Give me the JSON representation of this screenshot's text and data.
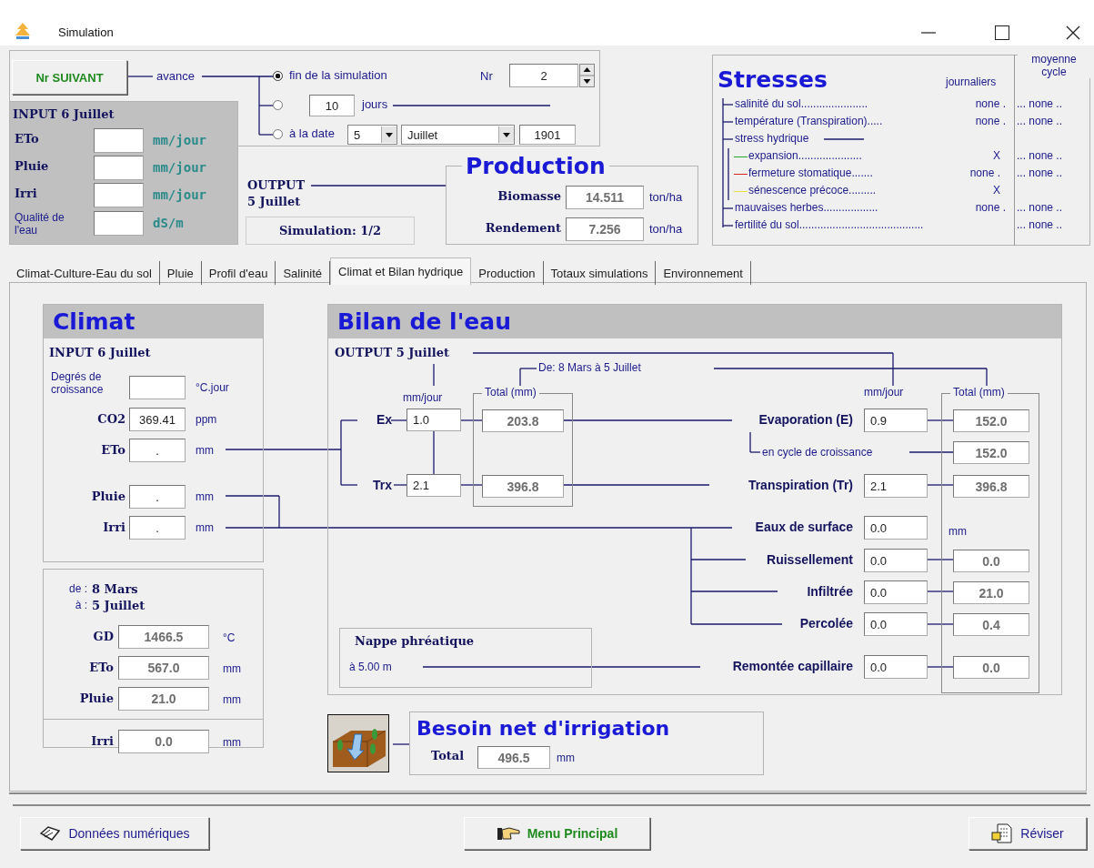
{
  "window": {
    "title": "Simulation"
  },
  "header": {
    "next_button": "Nr SUIVANT",
    "advance_label": "avance",
    "advance_options": [
      {
        "kind": "end",
        "label": "fin de la simulation",
        "selected": true
      },
      {
        "kind": "days",
        "value": "10",
        "label": "jours",
        "selected": false
      },
      {
        "kind": "date",
        "label": "à la date",
        "day": "5",
        "month": "Juillet",
        "year": "1901",
        "selected": false
      }
    ],
    "nr_label": "Nr",
    "nr_value": "2",
    "input": {
      "title": "INPUT",
      "date": "6 Juillet",
      "rows": [
        {
          "kind": "big",
          "label": "ETo",
          "unit": "mm/jour"
        },
        {
          "kind": "big",
          "label": "Pluie",
          "unit": "mm/jour"
        },
        {
          "kind": "big",
          "label": "Irri",
          "unit": "mm/jour"
        },
        {
          "kind": "small",
          "label": "Qualité de l'eau",
          "unit": "dS/m"
        }
      ]
    },
    "output": {
      "title": "OUTPUT",
      "date": "5 Juillet",
      "simulation": "Simulation: 1/2"
    },
    "production": {
      "title": "Production",
      "rows": [
        {
          "label": "Biomasse",
          "value": "14.511",
          "unit": "ton/ha"
        },
        {
          "label": "Rendement",
          "value": "7.256",
          "unit": "ton/ha"
        }
      ]
    },
    "stresses": {
      "title": "Stresses",
      "col_daily": "journaliers",
      "col_cycle": "moyenne cycle",
      "rows": [
        {
          "label": "salinité du sol......................",
          "daily": "none .",
          "cycle": "... none .."
        },
        {
          "label": "température (Transpiration).....",
          "daily": "none .",
          "cycle": "... none .."
        },
        {
          "label": "stress hydrique",
          "children": [
            {
              "label": "expansion.....................",
              "daily": "X",
              "cycle": "... none ..",
              "color": "#22aa22"
            },
            {
              "label": "fermeture stomatique.......",
              "daily": "none .",
              "cycle": "... none ..",
              "color": "#dd2222"
            },
            {
              "label": "sénescence précoce.........",
              "daily": "X",
              "color": "#e8e040"
            }
          ]
        },
        {
          "label": "mauvaises herbes..................",
          "daily": "none .",
          "cycle": "... none .."
        },
        {
          "label": "fertilité du sol.........................................",
          "cycle": "... none .."
        }
      ]
    }
  },
  "tabs": [
    {
      "label": "Climat-Culture-Eau du sol",
      "selected": false
    },
    {
      "label": "Pluie",
      "selected": false
    },
    {
      "label": "Profil d'eau",
      "selected": false
    },
    {
      "label": "Salinité",
      "selected": false
    },
    {
      "label": "Climat et Bilan hydrique",
      "selected": true
    },
    {
      "label": "Production",
      "selected": false
    },
    {
      "label": "Totaux simulations",
      "selected": false
    },
    {
      "label": "Environnement",
      "selected": false
    }
  ],
  "climat": {
    "title": "Climat",
    "input_title": "INPUT",
    "input_date": "6 Juillet",
    "rows": [
      {
        "kind": "small",
        "label": "Degrés de croissance",
        "unit": "°C.jour"
      },
      {
        "kind": "big",
        "label": "CO2",
        "value": "369.41",
        "unit": "ppm"
      },
      {
        "kind": "big",
        "label": "ETo",
        "value": ".",
        "unit": "mm"
      },
      {
        "kind": "big",
        "label": "Pluie",
        "value": ".",
        "unit": "mm"
      },
      {
        "kind": "big",
        "label": "Irri",
        "value": ".",
        "unit": "mm"
      }
    ],
    "from_label": "de :",
    "from_date": "8 Mars",
    "to_label": "à :",
    "to_date": "5 Juillet",
    "totals": [
      {
        "label": "GD",
        "value": "1466.5",
        "unit": "°C"
      },
      {
        "label": "ETo",
        "value": "567.0",
        "unit": "mm"
      },
      {
        "label": "Pluie",
        "value": "21.0",
        "unit": "mm"
      },
      {
        "label": "Irri",
        "value": "0.0",
        "unit": "mm"
      }
    ]
  },
  "bilan": {
    "title": "Bilan de l'eau",
    "output_title": "OUTPUT",
    "output_date": "5 Juillet",
    "period": "De: 8 Mars  à 5 Juillet",
    "left_daily_header": "mm/jour",
    "left_total_header": "Total (mm)",
    "left_rows": [
      {
        "label": "Ex",
        "daily": "1.0",
        "total": "203.8"
      },
      {
        "label": "Trx",
        "daily": "2.1",
        "total": "396.8"
      }
    ],
    "right_daily_header": "mm/jour",
    "right_total_header": "Total (mm)",
    "right_rows": [
      {
        "kind": "main",
        "label": "Evaporation (E)",
        "daily": "0.9",
        "total": "152.0"
      },
      {
        "kind": "sub",
        "label": "en cycle de croissance",
        "total": "152.0"
      },
      {
        "kind": "main",
        "label": "Transpiration (Tr)",
        "daily": "2.1",
        "total": "396.8"
      },
      {
        "kind": "unit",
        "label": "Eaux de surface",
        "daily": "0.0",
        "unit": "mm"
      },
      {
        "kind": "main",
        "label": "Ruissellement",
        "daily": "0.0",
        "total": "0.0"
      },
      {
        "kind": "main",
        "label": "Infiltrée",
        "daily": "0.0",
        "total": "21.0"
      },
      {
        "kind": "main",
        "label": "Percolée",
        "daily": "0.0",
        "total": "0.4"
      },
      {
        "kind": "main",
        "label": "Remontée capillaire",
        "daily": "0.0",
        "total": "0.0"
      }
    ],
    "water_table": {
      "title": "Nappe phréatique",
      "depth": "à  5.00 m"
    }
  },
  "irrigation": {
    "title": "Besoin net d'irrigation",
    "total_label": "Total",
    "value": "496.5",
    "unit": "mm"
  },
  "footer_buttons": [
    {
      "kind": "book",
      "label": "Données numériques"
    },
    {
      "kind": "hand",
      "label": "Menu Principal"
    },
    {
      "kind": "revise",
      "label": "Réviser"
    }
  ]
}
